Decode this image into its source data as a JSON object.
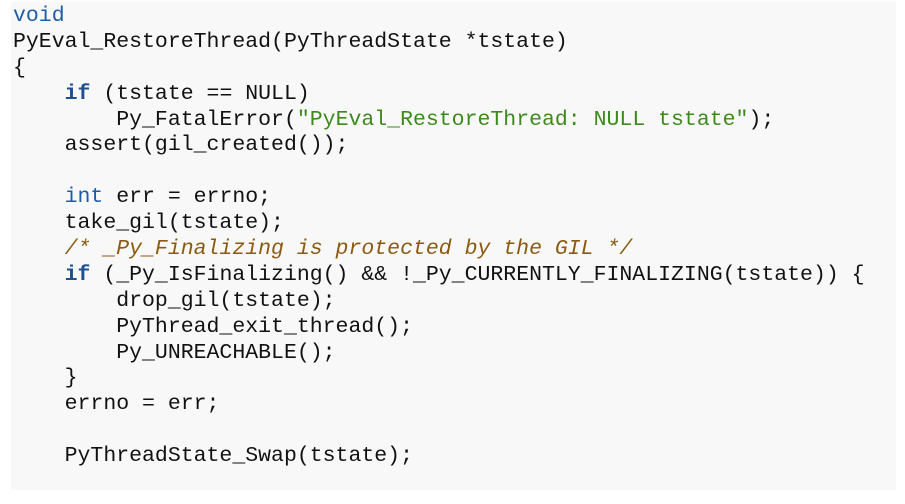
{
  "colors": {
    "background": "#ffffff",
    "panel": "#f8f8f8",
    "text": "#111111",
    "keyword": "#1f5ca8",
    "keyword_bold": "#1f4f8f",
    "string": "#3d8a1c",
    "comment": "#8b5a10"
  },
  "code": {
    "lines": [
      [
        {
          "t": "void",
          "c": "kw"
        }
      ],
      [
        {
          "t": "PyEval_RestoreThread(PyThreadState *tstate)",
          "c": "plain"
        }
      ],
      [
        {
          "t": "{",
          "c": "plain"
        }
      ],
      [
        {
          "t": "    ",
          "c": "plain"
        },
        {
          "t": "if",
          "c": "kwb"
        },
        {
          "t": " (tstate == NULL)",
          "c": "plain"
        }
      ],
      [
        {
          "t": "        Py_FatalError(",
          "c": "plain"
        },
        {
          "t": "\"PyEval_RestoreThread: NULL tstate\"",
          "c": "str"
        },
        {
          "t": ");",
          "c": "plain"
        }
      ],
      [
        {
          "t": "    assert(gil_created());",
          "c": "plain"
        }
      ],
      [
        {
          "t": "",
          "c": "plain"
        }
      ],
      [
        {
          "t": "    ",
          "c": "plain"
        },
        {
          "t": "int",
          "c": "kw"
        },
        {
          "t": " err = errno;",
          "c": "plain"
        }
      ],
      [
        {
          "t": "    take_gil(tstate);",
          "c": "plain"
        }
      ],
      [
        {
          "t": "    ",
          "c": "plain"
        },
        {
          "t": "/* _Py_Finalizing is protected by the GIL */",
          "c": "cmt"
        }
      ],
      [
        {
          "t": "    ",
          "c": "plain"
        },
        {
          "t": "if",
          "c": "kwb"
        },
        {
          "t": " (_Py_IsFinalizing() && !_Py_CURRENTLY_FINALIZING(tstate)) {",
          "c": "plain"
        }
      ],
      [
        {
          "t": "        drop_gil(tstate);",
          "c": "plain"
        }
      ],
      [
        {
          "t": "        PyThread_exit_thread();",
          "c": "plain"
        }
      ],
      [
        {
          "t": "        Py_UNREACHABLE();",
          "c": "plain"
        }
      ],
      [
        {
          "t": "    }",
          "c": "plain"
        }
      ],
      [
        {
          "t": "    errno = err;",
          "c": "plain"
        }
      ],
      [
        {
          "t": "",
          "c": "plain"
        }
      ],
      [
        {
          "t": "    PyThreadState_Swap(tstate);",
          "c": "plain"
        }
      ]
    ]
  }
}
